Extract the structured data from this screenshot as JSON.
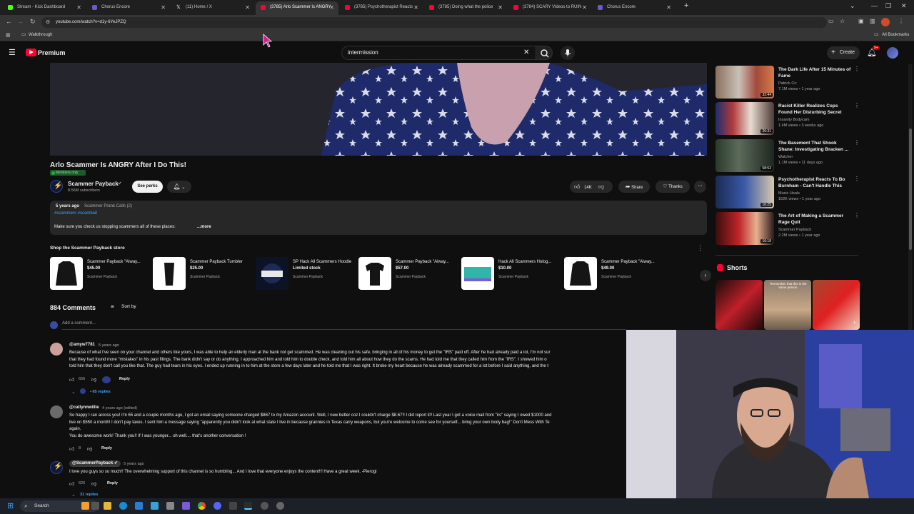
{
  "browser": {
    "tabs": [
      {
        "title": "Stream - Kick Dashboard",
        "color": "#53fc18"
      },
      {
        "title": "Chorus Encore",
        "color": "#6a5acd"
      },
      {
        "title": "(11) Home / X",
        "color": "#ffffff"
      },
      {
        "title": "(3785) Arlo Scammer Is ANGRY",
        "color": "#ff0033"
      },
      {
        "title": "(3785) Psychotherapist Reacts",
        "color": "#ff0033"
      },
      {
        "title": "(3785) Doing what the police",
        "color": "#ff0033"
      },
      {
        "title": "(3784) SCARY Videos to RUIN",
        "color": "#ff0033"
      },
      {
        "title": "Chorus Encore",
        "color": "#6a5acd"
      }
    ],
    "url": "youtube.com/watch?v=d1y-6YeJPZQ",
    "bookmark_folder": "Walkthrough",
    "all_bookmarks": "All Bookmarks"
  },
  "youtube": {
    "logo_text": "Premium",
    "search_value": "intermission",
    "create_label": "Create",
    "notif_badge": "9+"
  },
  "video": {
    "title": "Arlo Scammer Is ANGRY After I Do This!",
    "members_badge": "Members only",
    "channel_name": "Scammer Payback",
    "subscribers": "8.56M subscribers",
    "see_perks": "See perks",
    "likes": "14K",
    "share": "Share",
    "thanks": "Thanks"
  },
  "description": {
    "meta": "5 years ago",
    "playlist": "Scammer Prank Calls (2)",
    "hashtags": "#scammers #scambait",
    "snippet": "Make sure you check us stopping scammers all of these places:",
    "more": "...more"
  },
  "store": {
    "heading": "Shop the Scammer Payback store",
    "items": [
      {
        "title": "Scammer Payback \"Alway...",
        "price": "$45.00",
        "seller": "Scammer Payback"
      },
      {
        "title": "Scammer Payback Tumbler",
        "price": "$25.00",
        "seller": "Scammer Payback"
      },
      {
        "title": "SP Hack All Scammers Hoodie",
        "price": "Limited stock",
        "seller": "Scammer Payback"
      },
      {
        "title": "Scammer Payback \"Alway...",
        "price": "$57.00",
        "seller": "Scammer Payback"
      },
      {
        "title": "Hack All Scammers Holog...",
        "price": "$10.00",
        "seller": "Scammer Payback"
      },
      {
        "title": "Scammer Payback \"Alway...",
        "price": "$49.00",
        "seller": "Scammer Payback"
      }
    ]
  },
  "comments": {
    "count": "884 Comments",
    "sort_label": "Sort by",
    "add_placeholder": "Add a comment...",
    "items": [
      {
        "author": "@amyw7781",
        "time": "5 years ago",
        "lines": [
          "Because of what I've seen on your channel and others like yours, I was able to help an elderly man at the bank not get scammed. He was cleaning out his safe, bringing in all of his money to get the \"IRS\" paid off. After he had already paid a lot, I'm not sur",
          "that they had found more \"mistakes\" in his past filings. The bank didn't say or do anything. I approached him and told him to double check, and told him all about how they do the scams. He had told me that they called him from the \"IRS\". I showed him o",
          "told him that they don't call you like that. The guy had tears in his eyes. I ended up running in to him at the store a few days later and he told me that I was right. It broke my heart because he was already scammed for a lot before I said anything, and the t"
        ],
        "likes": "656",
        "reply": "Reply",
        "replies": "65 replies"
      },
      {
        "author": "@catlynnwillie",
        "time": "4 years ago (edited)",
        "lines": [
          "So happy I ran across you! I'm 65 and a couple months ago, I got an email saying someone charged $867 to my Amazon account. Well, I new better coz I couldn't charge $8.67!! I did report it!! Last year I got a voice mail from \"irs\" saying I owed $1000 and",
          "live on $550 a month! I don't pay taxes. I sent him a message saying \"apparently you didn't look at what state I live in because grannies in Texas carry weapons, but you're welcome to come see for yourself... bring your own body bag!\"  Don't Mess With Te",
          "again.",
          "You do awesome work! Thank you!! If I was younger... oh well.... that's another conversation !"
        ],
        "likes": "8",
        "reply": "Reply"
      },
      {
        "author": "@ScammerPayback",
        "time": "5 years ago",
        "lines": [
          "I love you guys so so much!!  The overwhelming support of this channel is so humbling... And I love that everyone enjoys the content!!! Have a great week. -Pierogi"
        ],
        "likes": "626",
        "reply": "Reply",
        "replies": "31 replies"
      }
    ]
  },
  "sidebar": {
    "videos": [
      {
        "title": "The Dark Life After 15 Minutes of Fame",
        "channel": "Patrick Cc:",
        "meta": "7.1M views • 1 year ago",
        "duration": "32:44"
      },
      {
        "title": "Racist Killer Realizes Cops Found Her Disturbing Secret",
        "channel": "Insanity Bodycam",
        "meta": "1.4M views • 3 weeks ago",
        "duration": "20:31"
      },
      {
        "title": "The Basement That Shook Shane: Investigating Bracken ...",
        "channel": "Watcher",
        "meta": "1.1M views • 11 days ago",
        "duration": "58:53"
      },
      {
        "title": "Psychotherapist Reacts To Bo Burnham - Can't Handle This",
        "channel": "Music Heals",
        "meta": "152K views • 1 year ago",
        "duration": "16:25"
      },
      {
        "title": "The Art of Making a Scammer Rage Quit",
        "channel": "Scammer Payback",
        "meta": "2.2M views • 1 year ago",
        "duration": "16:18"
      }
    ],
    "shorts_label": "Shorts",
    "short_caption": "Remember that this is the same person."
  },
  "taskbar": {
    "search_label": "Search"
  },
  "colors": {
    "accent_red": "#ff0033",
    "link_blue": "#3ea6ff",
    "bg": "#0f0f0f"
  }
}
